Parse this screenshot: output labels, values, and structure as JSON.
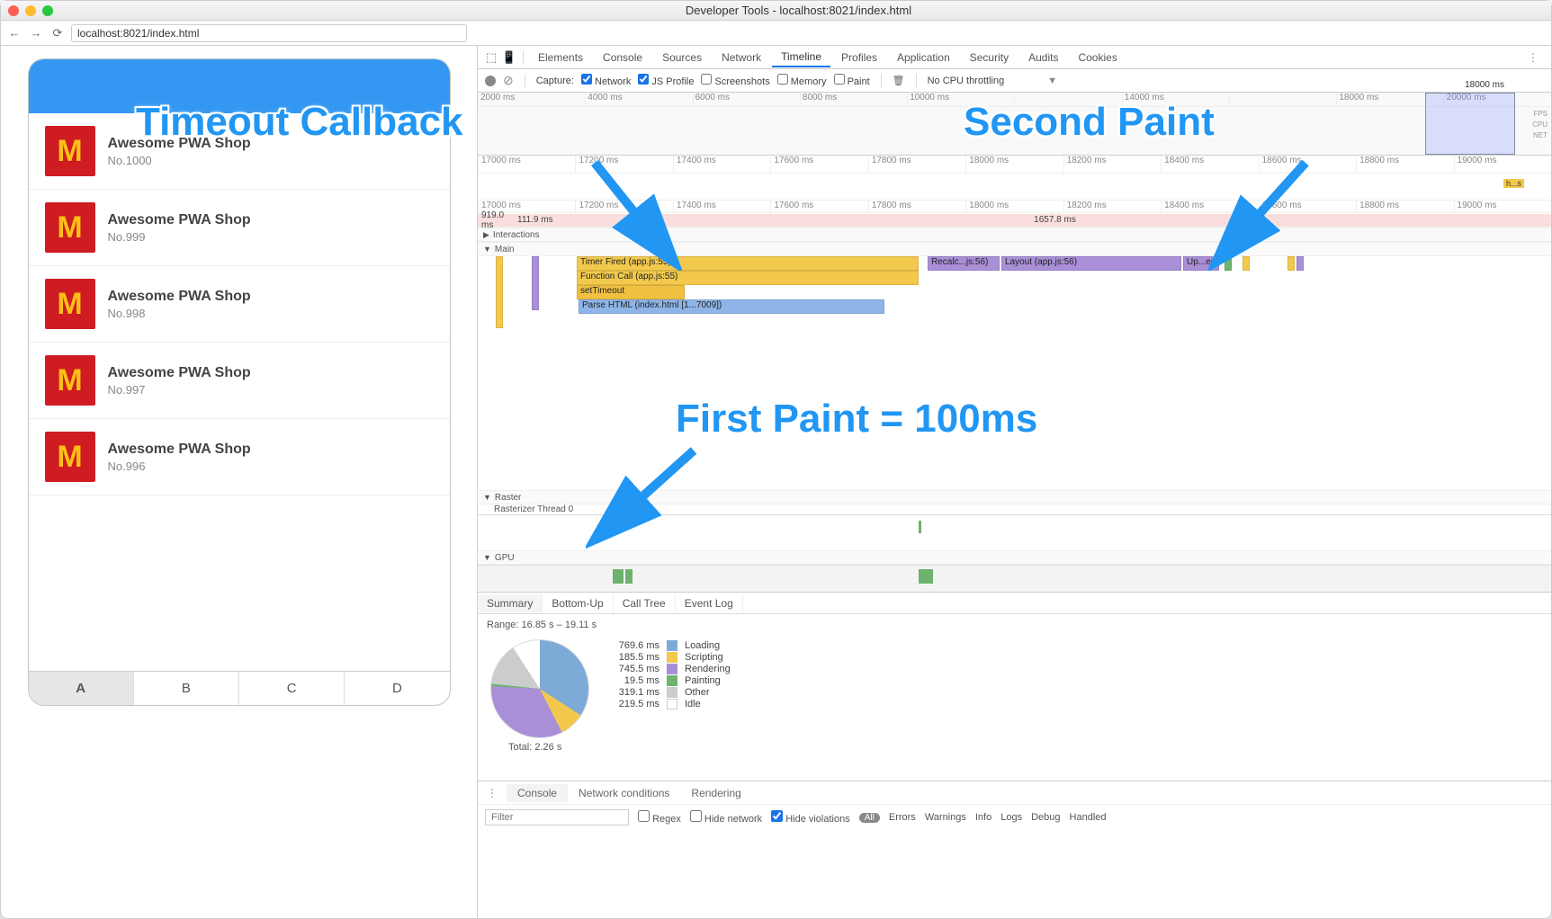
{
  "window": {
    "title": "Developer Tools - localhost:8021/index.html"
  },
  "browser": {
    "url": "localhost:8021/index.html"
  },
  "page": {
    "shop_items": [
      {
        "title": "Awesome PWA Shop",
        "sub": "No.1000"
      },
      {
        "title": "Awesome PWA Shop",
        "sub": "No.999"
      },
      {
        "title": "Awesome PWA Shop",
        "sub": "No.998"
      },
      {
        "title": "Awesome PWA Shop",
        "sub": "No.997"
      },
      {
        "title": "Awesome PWA Shop",
        "sub": "No.996"
      }
    ],
    "bottom_tabs": [
      "A",
      "B",
      "C",
      "D"
    ],
    "active_tab": "A"
  },
  "devtools": {
    "tabs": [
      "Elements",
      "Console",
      "Sources",
      "Network",
      "Timeline",
      "Profiles",
      "Application",
      "Security",
      "Audits",
      "Cookies"
    ],
    "active_tab": "Timeline",
    "capture": {
      "label": "Capture:",
      "network": {
        "label": "Network",
        "checked": true
      },
      "jsprofile": {
        "label": "JS Profile",
        "checked": true
      },
      "screenshots": {
        "label": "Screenshots",
        "checked": false
      },
      "memory": {
        "label": "Memory",
        "checked": false
      },
      "paint": {
        "label": "Paint",
        "checked": false
      },
      "throttle": "No CPU throttling"
    },
    "overview_ruler": [
      "2000 ms",
      "4000 ms",
      "6000 ms",
      "8000 ms",
      "10000 ms",
      "",
      "14000 ms",
      "",
      "18000 ms",
      "20000 ms"
    ],
    "overview_highlight_label": "18000 ms",
    "overview_right_labels": [
      "FPS",
      "CPU",
      "NET"
    ],
    "ruler_zoom_a": [
      "17000 ms",
      "17200 ms",
      "17400 ms",
      "17600 ms",
      "17800 ms",
      "18000 ms",
      "18200 ms",
      "18400 ms",
      "18600 ms",
      "18800 ms",
      "19000 ms"
    ],
    "ruler_zoom_b": [
      "17000 ms",
      "17200 ms",
      "17400 ms",
      "17600 ms",
      "17800 ms",
      "18000 ms",
      "18200 ms",
      "18400 ms",
      "18600 ms",
      "18800 ms",
      "19000 ms"
    ],
    "timings": {
      "left": "919.0 ms",
      "first": "111.9 ms",
      "big": "1657.8 ms",
      "right": "h...s"
    },
    "sections": {
      "interactions": "Interactions",
      "main": "Main",
      "raster": "Raster",
      "raster_thread": "Rasterizer Thread 0",
      "gpu": "GPU"
    },
    "flame": {
      "timer_fired": "Timer Fired (app.js:55)",
      "function_call": "Function Call (app.js:55)",
      "set_timeout": "setTimeout",
      "parse_html": "Parse HTML (index.html [1...7009])",
      "recalc": "Recalc...js:56)",
      "layout": "Layout (app.js:56)",
      "update": "Up...ee"
    },
    "summary": {
      "tabs": [
        "Summary",
        "Bottom-Up",
        "Call Tree",
        "Event Log"
      ],
      "active": "Summary",
      "range": "Range: 16.85 s – 19.11 s",
      "legend": [
        {
          "ms": "769.6 ms",
          "label": "Loading",
          "color": "#7eaad8"
        },
        {
          "ms": "185.5 ms",
          "label": "Scripting",
          "color": "#f2c94c"
        },
        {
          "ms": "745.5 ms",
          "label": "Rendering",
          "color": "#a98fd8"
        },
        {
          "ms": "19.5 ms",
          "label": "Painting",
          "color": "#6fb36f"
        },
        {
          "ms": "319.1 ms",
          "label": "Other",
          "color": "#cccccc"
        },
        {
          "ms": "219.5 ms",
          "label": "Idle",
          "color": "#ffffff"
        }
      ],
      "total": "Total: 2.26 s"
    },
    "drawer": {
      "tabs": [
        "Console",
        "Network conditions",
        "Rendering"
      ],
      "active": "Console",
      "filter_placeholder": "Filter",
      "regex": {
        "label": "Regex",
        "checked": false
      },
      "hide_network": {
        "label": "Hide network",
        "checked": false
      },
      "hide_violations": {
        "label": "Hide violations",
        "checked": true
      },
      "chips": [
        "All",
        "Errors",
        "Warnings",
        "Info",
        "Logs",
        "Debug",
        "Handled"
      ]
    }
  },
  "annotations": {
    "timeout_callback": "Timeout Callback",
    "second_paint": "Second Paint",
    "first_paint": "First Paint = 100ms"
  }
}
